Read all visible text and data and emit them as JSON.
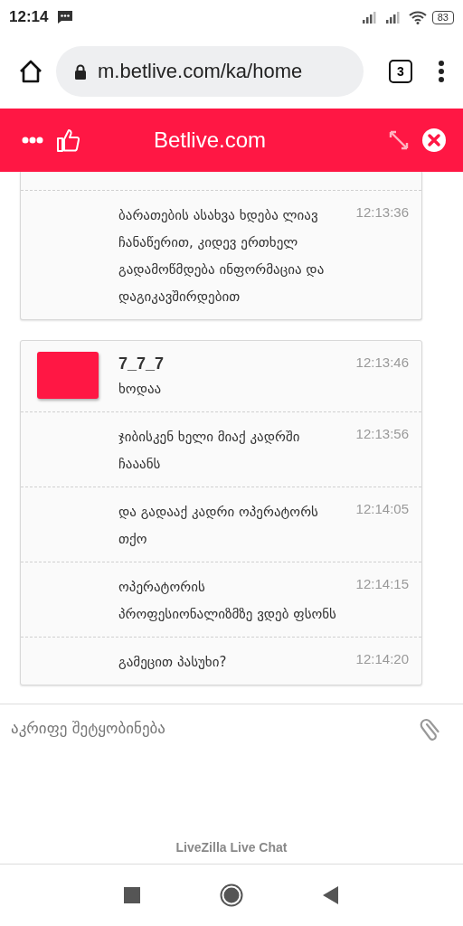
{
  "status_bar": {
    "time": "12:14",
    "battery": "83"
  },
  "browser": {
    "url": "m.betlive.com/ka/home",
    "tab_count": "3"
  },
  "chat_header": {
    "title": "Betlive.com"
  },
  "groups": [
    {
      "cut_top": true,
      "messages": [
        {
          "text": "ბარათების ასახვა ხდება ლიავ ჩანაწერით, კიდევ ერთხელ გადამოწმდება ინფორმაცია და დაგიკავშირდებით",
          "time": "12:13:36"
        }
      ]
    },
    {
      "author": "7_7_7",
      "color": "#ff1744",
      "cut_top": false,
      "messages": [
        {
          "text": "ხოდაა",
          "time": "12:13:46"
        },
        {
          "text": "ჯიბისკენ ხელი მიაქ კადრში ჩააანს",
          "time": "12:13:56"
        },
        {
          "text": "და გადააქ კადრი ოპერატორს თქო",
          "time": "12:14:05"
        },
        {
          "text": "ოპერატორის პროფესიონალიზმზე ვდებ ფსონს",
          "time": "12:14:15"
        },
        {
          "text": "გამეცით პასუხი?",
          "time": "12:14:20"
        }
      ]
    }
  ],
  "composer": {
    "placeholder": "აკრიფე შეტყობინება"
  },
  "footer": "LiveZilla Live Chat"
}
